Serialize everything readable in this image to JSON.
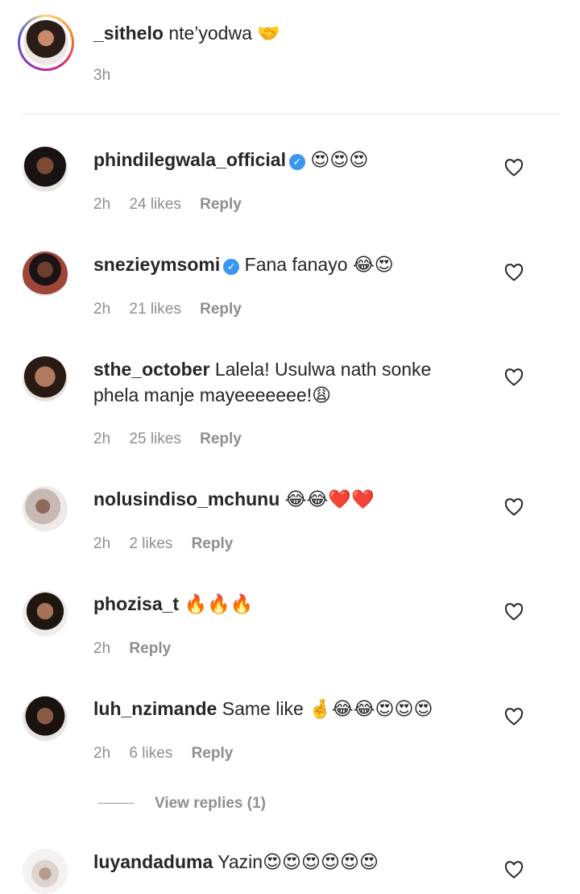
{
  "caption": {
    "username": "_sithelo",
    "text": "nte’yodwa 🤝",
    "time": "3h"
  },
  "comments": [
    {
      "username": "phindilegwala_official",
      "verified": true,
      "text": "😍😍😍",
      "time": "2h",
      "likes": "24 likes",
      "reply": "Reply"
    },
    {
      "username": "snezieymsomi",
      "verified": true,
      "text": "Fana fanayo 😂😍",
      "time": "2h",
      "likes": "21 likes",
      "reply": "Reply"
    },
    {
      "username": "sthe_october",
      "verified": false,
      "text": "Lalela! Usulwa nath sonke phela manje mayeeeeeee!😩",
      "time": "2h",
      "likes": "25 likes",
      "reply": "Reply"
    },
    {
      "username": "nolusindiso_mchunu",
      "verified": false,
      "text": "😂😂❤️❤️",
      "time": "2h",
      "likes": "2 likes",
      "reply": "Reply"
    },
    {
      "username": "phozisa_t",
      "verified": false,
      "text": "🔥🔥🔥",
      "time": "2h",
      "likes": "",
      "reply": "Reply"
    },
    {
      "username": "luh_nzimande",
      "verified": false,
      "text": "Same like 🤞😂😂😍😍😍",
      "time": "2h",
      "likes": "6 likes",
      "reply": "Reply"
    },
    {
      "username": "luyandaduma",
      "verified": false,
      "text": "Yazin😍😍😍😍😍😍",
      "time": "",
      "likes": "",
      "reply": ""
    }
  ],
  "view_replies": "View replies (1)",
  "icons": {
    "like": "heart-outline-icon",
    "verified": "verified-badge-icon"
  },
  "colors": {
    "verified": "#3897f0",
    "muted": "#8e8e8e",
    "text": "#262626"
  }
}
